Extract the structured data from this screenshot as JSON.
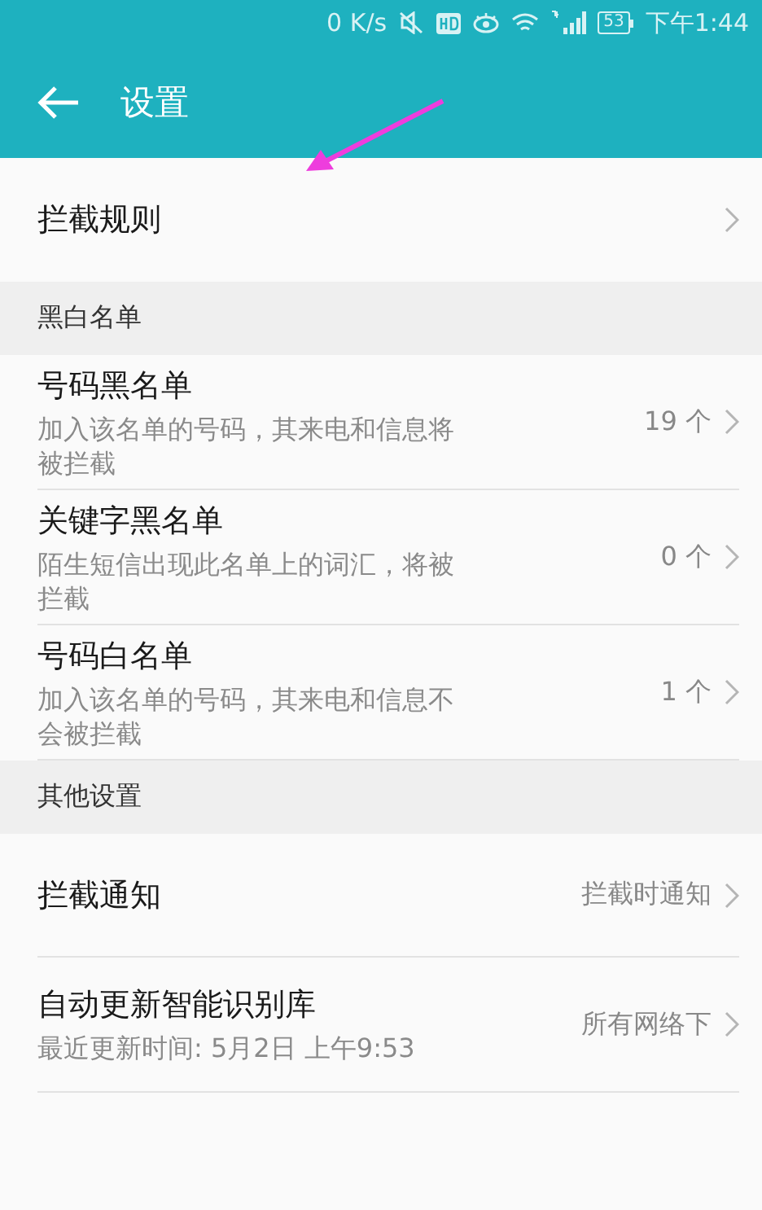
{
  "status_bar": {
    "speed": "0 K/s",
    "battery": "53",
    "time": "下午1:44"
  },
  "header": {
    "title": "设置"
  },
  "sections": [
    {
      "items": [
        {
          "title": "拦截规则"
        }
      ]
    },
    {
      "title": "黑白名单",
      "items": [
        {
          "title": "号码黑名单",
          "subtitle": "加入该名单的号码，其来电和信息将被拦截",
          "value": "19 个"
        },
        {
          "title": "关键字黑名单",
          "subtitle": "陌生短信出现此名单上的词汇，将被拦截",
          "value": "0 个"
        },
        {
          "title": "号码白名单",
          "subtitle": "加入该名单的号码，其来电和信息不会被拦截",
          "value": "1 个"
        }
      ]
    },
    {
      "title": "其他设置",
      "items": [
        {
          "title": "拦截通知",
          "value": "拦截时通知"
        },
        {
          "title": "自动更新智能识别库",
          "subtitle": "最近更新时间: 5月2日 上午9:53",
          "value": "所有网络下"
        }
      ]
    }
  ]
}
